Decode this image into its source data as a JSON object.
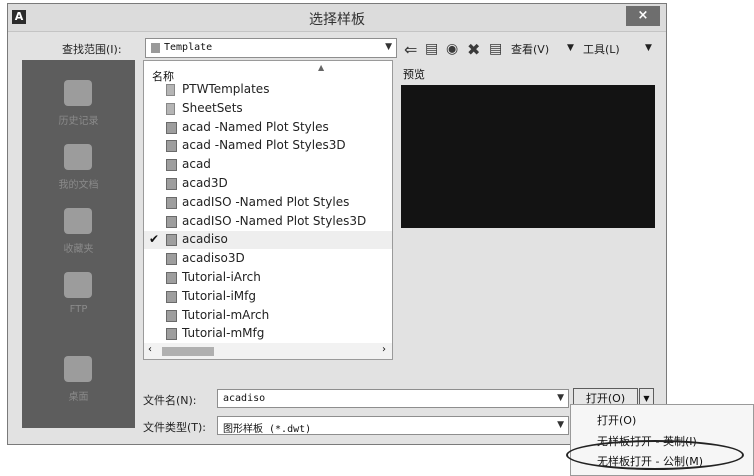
{
  "window": {
    "title": "选择样板",
    "app_glyph": "A",
    "close_glyph": "×"
  },
  "lookin": {
    "label": "查找范围(I):",
    "value": "Template"
  },
  "toolbar": {
    "view_label": "查看(V)",
    "tools_label": "工具(L)"
  },
  "places": [
    {
      "label": "历史记录"
    },
    {
      "label": "我的文档"
    },
    {
      "label": "收藏夹"
    },
    {
      "label": "FTP"
    },
    {
      "label": "桌面"
    }
  ],
  "files": {
    "column_name": "名称",
    "items": [
      {
        "name": "PTWTemplates",
        "type": "folder",
        "selected": false
      },
      {
        "name": "SheetSets",
        "type": "folder",
        "selected": false
      },
      {
        "name": "acad -Named Plot Styles",
        "type": "file",
        "selected": false
      },
      {
        "name": "acad -Named Plot Styles3D",
        "type": "file",
        "selected": false
      },
      {
        "name": "acad",
        "type": "file",
        "selected": false
      },
      {
        "name": "acad3D",
        "type": "file",
        "selected": false
      },
      {
        "name": "acadISO -Named Plot Styles",
        "type": "file",
        "selected": false
      },
      {
        "name": "acadISO -Named Plot Styles3D",
        "type": "file",
        "selected": false
      },
      {
        "name": "acadiso",
        "type": "file",
        "selected": true
      },
      {
        "name": "acadiso3D",
        "type": "file",
        "selected": false
      },
      {
        "name": "Tutorial-iArch",
        "type": "file",
        "selected": false
      },
      {
        "name": "Tutorial-iMfg",
        "type": "file",
        "selected": false
      },
      {
        "name": "Tutorial-mArch",
        "type": "file",
        "selected": false
      },
      {
        "name": "Tutorial-mMfg",
        "type": "file",
        "selected": false
      }
    ],
    "check_glyph": "✔"
  },
  "preview": {
    "label": "预览"
  },
  "filename": {
    "label": "文件名(N):",
    "value": "acadiso"
  },
  "filetype": {
    "label": "文件类型(T):",
    "value": "图形样板 (*.dwt)"
  },
  "open_button": {
    "label": "打开(O)"
  },
  "open_menu": {
    "items": [
      {
        "label": "打开(O)"
      },
      {
        "label": "无样板打开 - 英制(I)"
      },
      {
        "label": "无样板打开 - 公制(M)"
      }
    ]
  }
}
